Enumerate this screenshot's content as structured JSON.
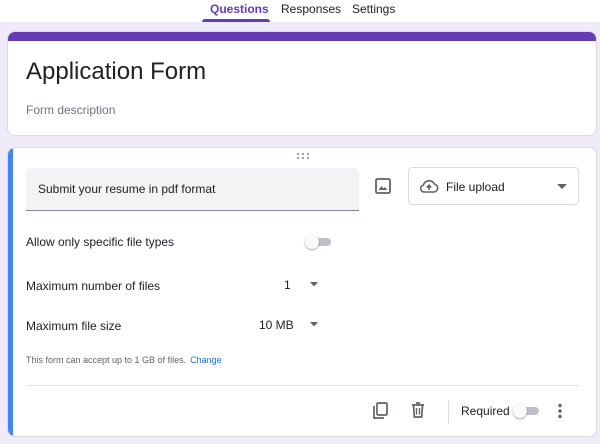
{
  "tabs": [
    {
      "label": "Questions",
      "active": true
    },
    {
      "label": "Responses",
      "active": false
    },
    {
      "label": "Settings",
      "active": false
    }
  ],
  "form": {
    "title": "Application Form",
    "description_placeholder": "Form description"
  },
  "question": {
    "title": "Submit your resume in pdf format",
    "type_label": "File upload",
    "type_icon": "cloud-upload-icon",
    "settings": {
      "allow_specific_types_label": "Allow only specific file types",
      "allow_specific_types_on": false,
      "max_files_label": "Maximum number of files",
      "max_files_value": "1",
      "max_size_label": "Maximum file size",
      "max_size_value": "10 MB"
    },
    "note": "This form can accept up to 1 GB of files.",
    "note_link": "Change",
    "footer": {
      "required_label": "Required",
      "required_on": false
    }
  },
  "colors": {
    "accent": "#673ab7",
    "active_card_bar": "#4285f4",
    "link": "#1a73e8",
    "background": "#f0ebf8"
  }
}
